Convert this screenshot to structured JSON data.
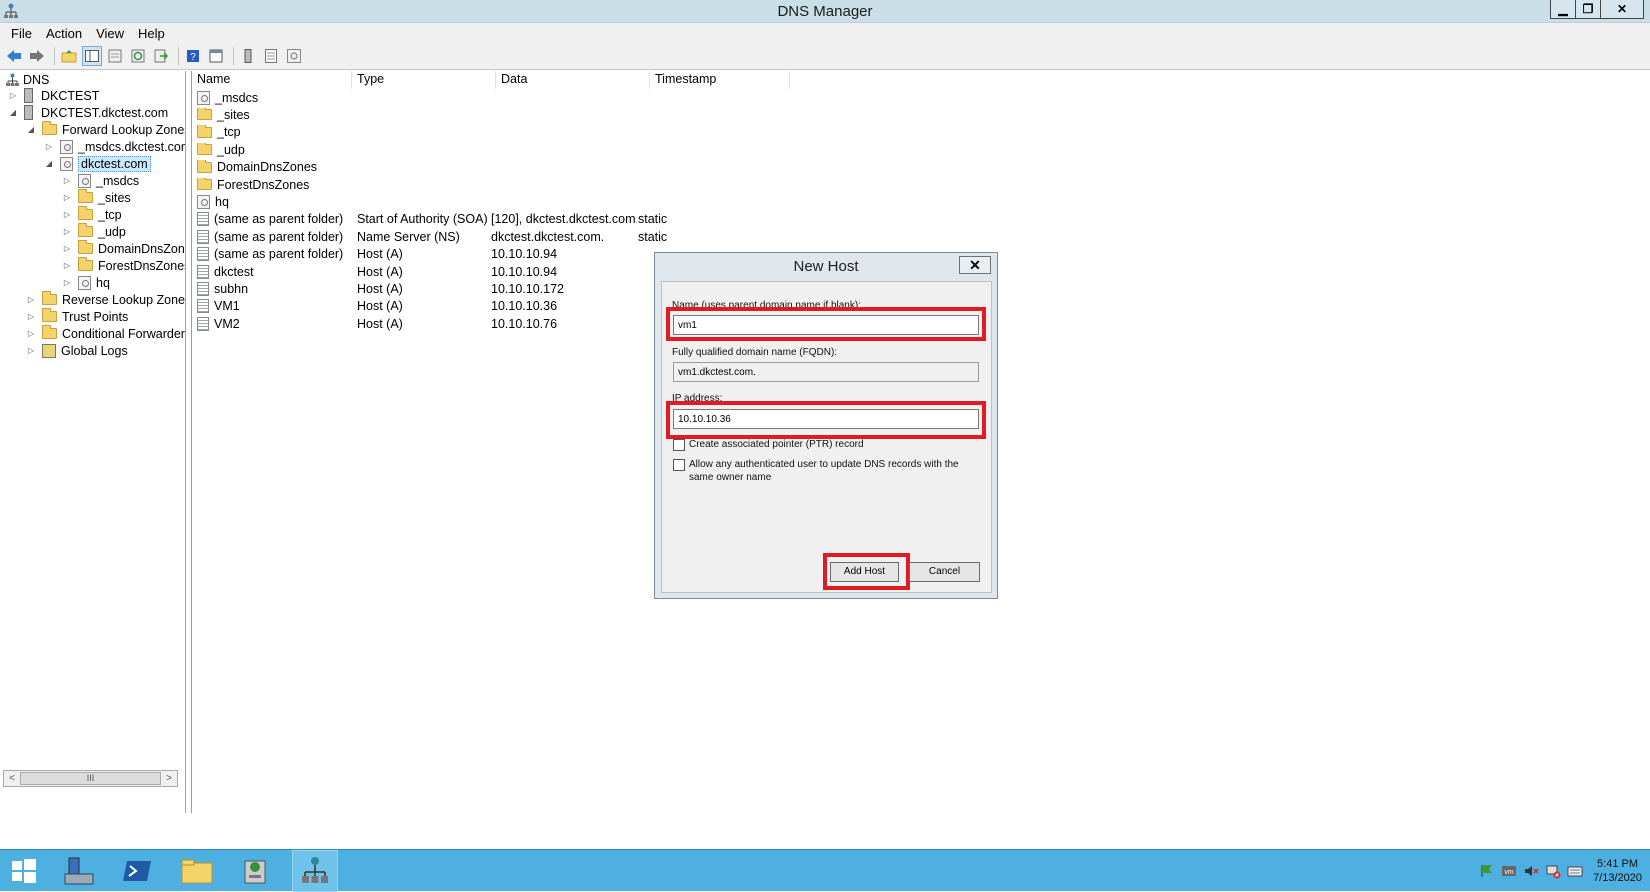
{
  "window": {
    "title": "DNS Manager",
    "minimize": "▁",
    "restore": "❐",
    "close": "✕"
  },
  "menu": [
    "File",
    "Action",
    "View",
    "Help"
  ],
  "toolbar": {
    "icons": [
      "back-icon",
      "forward-icon",
      "up-folder-icon",
      "show-hide-tree-icon",
      "properties-icon",
      "refresh-icon",
      "export-icon",
      "help-icon",
      "console-icon",
      "server-icon",
      "record-icon",
      "zone-icon"
    ]
  },
  "tree": [
    {
      "label": "DNS",
      "level": 0,
      "icon": "dns-icon",
      "expander": ""
    },
    {
      "label": "DKCTEST",
      "level": 1,
      "icon": "server-icon",
      "expander": "▷"
    },
    {
      "label": "DKCTEST.dkctest.com",
      "level": 1,
      "icon": "server-icon",
      "expander": "◢"
    },
    {
      "label": "Forward Lookup Zones",
      "level": 2,
      "icon": "folder-icon",
      "expander": "◢"
    },
    {
      "label": "_msdcs.dkctest.com",
      "level": 3,
      "icon": "zone-icon",
      "expander": "▷"
    },
    {
      "label": "dkctest.com",
      "level": 3,
      "icon": "zone-icon",
      "expander": "◢",
      "selected": true
    },
    {
      "label": "_msdcs",
      "level": 4,
      "icon": "zone-icon",
      "expander": "▷"
    },
    {
      "label": "_sites",
      "level": 4,
      "icon": "folder-icon",
      "expander": "▷"
    },
    {
      "label": "_tcp",
      "level": 4,
      "icon": "folder-icon",
      "expander": "▷"
    },
    {
      "label": "_udp",
      "level": 4,
      "icon": "folder-icon",
      "expander": "▷"
    },
    {
      "label": "DomainDnsZones",
      "level": 4,
      "icon": "folder-icon",
      "expander": "▷"
    },
    {
      "label": "ForestDnsZones",
      "level": 4,
      "icon": "folder-icon",
      "expander": "▷"
    },
    {
      "label": "hq",
      "level": 4,
      "icon": "zone-icon",
      "expander": "▷"
    },
    {
      "label": "Reverse Lookup Zones",
      "level": 2,
      "icon": "folder-icon",
      "expander": "▷"
    },
    {
      "label": "Trust Points",
      "level": 2,
      "icon": "folder-icon",
      "expander": "▷"
    },
    {
      "label": "Conditional Forwarders",
      "level": 2,
      "icon": "folder-icon",
      "expander": "▷"
    },
    {
      "label": "Global Logs",
      "level": 2,
      "icon": "logs-icon",
      "expander": "▷"
    }
  ],
  "tree_scroll": {
    "left": "<",
    "thumb": "III",
    "right": ">"
  },
  "list": {
    "columns": [
      "Name",
      "Type",
      "Data",
      "Timestamp"
    ],
    "rows": [
      {
        "name": "_msdcs",
        "type": "",
        "data": "",
        "timestamp": "",
        "icon": "zone-icon"
      },
      {
        "name": "_sites",
        "type": "",
        "data": "",
        "timestamp": "",
        "icon": "folder-icon"
      },
      {
        "name": "_tcp",
        "type": "",
        "data": "",
        "timestamp": "",
        "icon": "folder-icon"
      },
      {
        "name": "_udp",
        "type": "",
        "data": "",
        "timestamp": "",
        "icon": "folder-icon"
      },
      {
        "name": "DomainDnsZones",
        "type": "",
        "data": "",
        "timestamp": "",
        "icon": "folder-icon"
      },
      {
        "name": "ForestDnsZones",
        "type": "",
        "data": "",
        "timestamp": "",
        "icon": "folder-icon"
      },
      {
        "name": "hq",
        "type": "",
        "data": "",
        "timestamp": "",
        "icon": "zone-icon"
      },
      {
        "name": "(same as parent folder)",
        "type": "Start of Authority (SOA)",
        "data": "[120], dkctest.dkctest.com...",
        "timestamp": "static",
        "icon": "record-icon"
      },
      {
        "name": "(same as parent folder)",
        "type": "Name Server (NS)",
        "data": "dkctest.dkctest.com.",
        "timestamp": "static",
        "icon": "record-icon"
      },
      {
        "name": "(same as parent folder)",
        "type": "Host (A)",
        "data": "10.10.10.94",
        "timestamp": "",
        "icon": "record-icon"
      },
      {
        "name": "dkctest",
        "type": "Host (A)",
        "data": "10.10.10.94",
        "timestamp": "",
        "icon": "record-icon"
      },
      {
        "name": "subhn",
        "type": "Host (A)",
        "data": "10.10.10.172",
        "timestamp": "",
        "icon": "record-icon"
      },
      {
        "name": "VM1",
        "type": "Host (A)",
        "data": "10.10.10.36",
        "timestamp": "",
        "icon": "record-icon"
      },
      {
        "name": "VM2",
        "type": "Host (A)",
        "data": "10.10.10.76",
        "timestamp": "",
        "icon": "record-icon"
      }
    ]
  },
  "dialog": {
    "title": "New Host",
    "close": "✕",
    "name_label": "Name (uses parent domain name if blank):",
    "name_value": "vm1",
    "fqdn_label": "Fully qualified domain name (FQDN):",
    "fqdn_value": "vm1.dkctest.com.",
    "ip_label": "IP address:",
    "ip_value": "10.10.10.36",
    "ptr_label": "Create associated pointer (PTR) record",
    "ptr_checked": false,
    "allow_label_1": "Allow any authenticated user to update DNS records with the",
    "allow_label_2": "same owner name",
    "allow_checked": false,
    "add_host": "Add Host",
    "cancel": "Cancel"
  },
  "highlight_color": "#e01b24",
  "taskbar": {
    "apps": [
      "start-icon",
      "server-manager-icon",
      "powershell-icon",
      "file-explorer-icon",
      "admin-tools-icon",
      "dns-manager-icon"
    ],
    "clock_time": "5:41 PM",
    "clock_date": "7/13/2020"
  }
}
